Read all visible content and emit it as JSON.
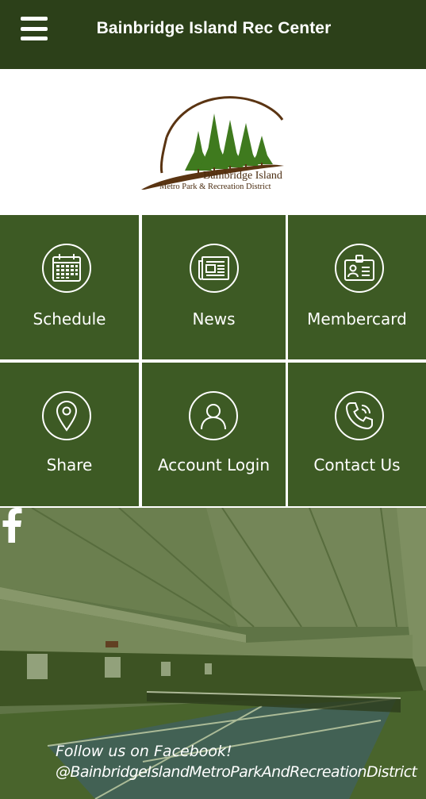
{
  "header": {
    "title": "Bainbridge Island Rec Center",
    "menu_icon": "hamburger-menu-icon"
  },
  "logo": {
    "line1": "Bainbridge Island",
    "line2": "Metro Park & Recreation District"
  },
  "tiles": [
    {
      "label": "Schedule",
      "icon": "calendar-icon"
    },
    {
      "label": "News",
      "icon": "newspaper-icon"
    },
    {
      "label": "Membercard",
      "icon": "id-card-icon"
    },
    {
      "label": "Share",
      "icon": "map-pin-icon"
    },
    {
      "label": "Account Login",
      "icon": "user-icon"
    },
    {
      "label": "Contact Us",
      "icon": "phone-icon"
    }
  ],
  "footer": {
    "line1": "Follow us on Facebook!",
    "line2": "@BainbridgeIslandMetroParkAndRecreationDistrict",
    "icon": "facebook-icon"
  },
  "colors": {
    "header": "#2c4019",
    "tile": "#3d5a24",
    "overlay": "#4b6a2a"
  }
}
